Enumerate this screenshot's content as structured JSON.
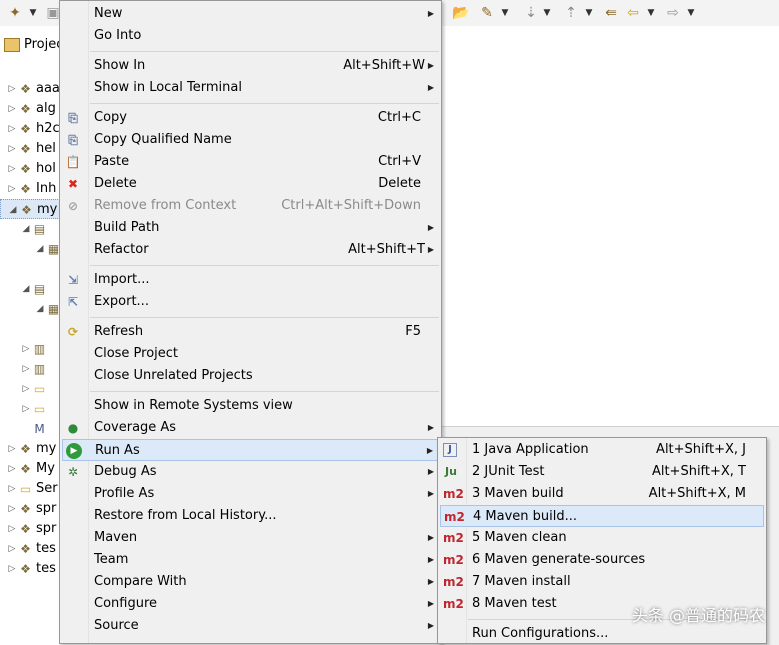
{
  "explorer": {
    "tab_label": "Projec",
    "rows": [
      {
        "label": "aaa"
      },
      {
        "label": "alg"
      },
      {
        "label": "h2c"
      },
      {
        "label": "hel"
      },
      {
        "label": "hol"
      },
      {
        "label": "Inh"
      },
      {
        "label": "my"
      },
      {
        "label": ""
      },
      {
        "label": ""
      },
      {
        "label": ""
      },
      {
        "label": ""
      },
      {
        "label": ""
      },
      {
        "label": ""
      },
      {
        "label": ""
      },
      {
        "label": ""
      },
      {
        "label": ""
      },
      {
        "label": "my"
      },
      {
        "label": "My"
      },
      {
        "label": "Ser"
      },
      {
        "label": "spr"
      },
      {
        "label": "spr"
      },
      {
        "label": "tes"
      },
      {
        "label": "tes"
      }
    ]
  },
  "context_menu": {
    "items": [
      {
        "label": "New",
        "shortcut": "",
        "submenu": true,
        "icon": ""
      },
      {
        "label": "Go Into",
        "shortcut": "",
        "submenu": false,
        "icon": ""
      },
      {
        "label": "Show In",
        "shortcut": "Alt+Shift+W",
        "submenu": true,
        "icon": ""
      },
      {
        "label": "Show in Local Terminal",
        "shortcut": "",
        "submenu": true,
        "icon": ""
      },
      {
        "label": "Copy",
        "shortcut": "Ctrl+C",
        "submenu": false,
        "icon": "copy-icon"
      },
      {
        "label": "Copy Qualified Name",
        "shortcut": "",
        "submenu": false,
        "icon": "copy-qualified-icon"
      },
      {
        "label": "Paste",
        "shortcut": "Ctrl+V",
        "submenu": false,
        "icon": "paste-icon"
      },
      {
        "label": "Delete",
        "shortcut": "Delete",
        "submenu": false,
        "icon": "delete-icon"
      },
      {
        "label": "Remove from Context",
        "shortcut": "Ctrl+Alt+Shift+Down",
        "submenu": false,
        "icon": "remove-context-icon",
        "disabled": true
      },
      {
        "label": "Build Path",
        "shortcut": "",
        "submenu": true,
        "icon": ""
      },
      {
        "label": "Refactor",
        "shortcut": "Alt+Shift+T",
        "submenu": true,
        "icon": ""
      },
      {
        "label": "Import...",
        "shortcut": "",
        "submenu": false,
        "icon": "import-icon"
      },
      {
        "label": "Export...",
        "shortcut": "",
        "submenu": false,
        "icon": "export-icon"
      },
      {
        "label": "Refresh",
        "shortcut": "F5",
        "submenu": false,
        "icon": "refresh-icon"
      },
      {
        "label": "Close Project",
        "shortcut": "",
        "submenu": false,
        "icon": ""
      },
      {
        "label": "Close Unrelated Projects",
        "shortcut": "",
        "submenu": false,
        "icon": ""
      },
      {
        "label": "Show in Remote Systems view",
        "shortcut": "",
        "submenu": false,
        "icon": ""
      },
      {
        "label": "Coverage As",
        "shortcut": "",
        "submenu": true,
        "icon": "coverage-icon"
      },
      {
        "label": "Run As",
        "shortcut": "",
        "submenu": true,
        "icon": "run-icon",
        "highlighted": true
      },
      {
        "label": "Debug As",
        "shortcut": "",
        "submenu": true,
        "icon": "debug-icon"
      },
      {
        "label": "Profile As",
        "shortcut": "",
        "submenu": true,
        "icon": ""
      },
      {
        "label": "Restore from Local History...",
        "shortcut": "",
        "submenu": false,
        "icon": ""
      },
      {
        "label": "Maven",
        "shortcut": "",
        "submenu": true,
        "icon": ""
      },
      {
        "label": "Team",
        "shortcut": "",
        "submenu": true,
        "icon": ""
      },
      {
        "label": "Compare With",
        "shortcut": "",
        "submenu": true,
        "icon": ""
      },
      {
        "label": "Configure",
        "shortcut": "",
        "submenu": true,
        "icon": ""
      },
      {
        "label": "Source",
        "shortcut": "",
        "submenu": true,
        "icon": ""
      }
    ]
  },
  "run_as_submenu": {
    "items": [
      {
        "label": "1 Java Application",
        "shortcut": "Alt+Shift+X, J",
        "icon": "java-app-icon",
        "badge": "J"
      },
      {
        "label": "2 JUnit Test",
        "shortcut": "Alt+Shift+X, T",
        "icon": "junit-icon",
        "badge": "Ju"
      },
      {
        "label": "3 Maven build",
        "shortcut": "Alt+Shift+X, M",
        "icon": "maven-icon",
        "badge": "m2"
      },
      {
        "label": "4 Maven build...",
        "shortcut": "",
        "icon": "maven-icon",
        "badge": "m2",
        "highlighted": true
      },
      {
        "label": "5 Maven clean",
        "shortcut": "",
        "icon": "maven-icon",
        "badge": "m2"
      },
      {
        "label": "6 Maven generate-sources",
        "shortcut": "",
        "icon": "maven-icon",
        "badge": "m2"
      },
      {
        "label": "7 Maven install",
        "shortcut": "",
        "icon": "maven-icon",
        "badge": "m2"
      },
      {
        "label": "8 Maven test",
        "shortcut": "",
        "icon": "maven-icon",
        "badge": "m2"
      },
      {
        "label": "Run Configurations...",
        "shortcut": "",
        "icon": "",
        "badge": ""
      }
    ]
  },
  "watermark": "头条 @普通的码农",
  "colors": {
    "menu_bg": "#f0f0f0",
    "highlight": "#dce9f8",
    "maven_red": "#c0262d"
  }
}
